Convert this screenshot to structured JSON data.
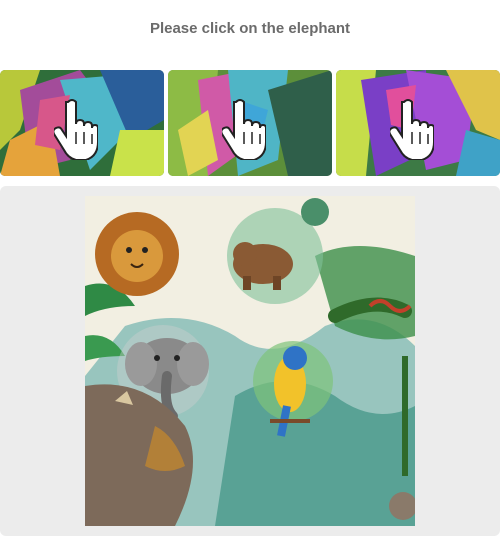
{
  "captcha": {
    "instruction": "Please click on the elephant",
    "examples": [
      {
        "name": "example-elephant-1"
      },
      {
        "name": "example-elephant-2"
      },
      {
        "name": "example-elephant-3"
      }
    ],
    "scene_animals": [
      "lion",
      "bear",
      "elephant",
      "parrot",
      "rhinoceros",
      "snake"
    ],
    "colors": {
      "panel_bg": "#ececec",
      "instruction_text": "#6b6b6b",
      "paper": "#f2efe2"
    }
  }
}
